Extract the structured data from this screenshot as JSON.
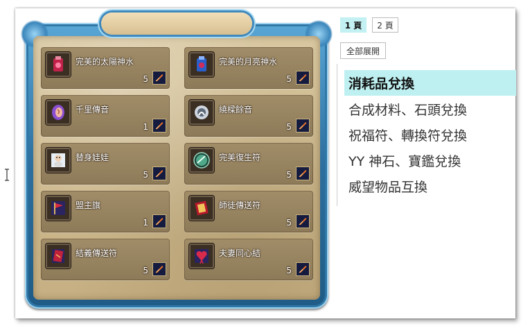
{
  "panel": {
    "items": [
      {
        "name": "完美的太陽神水",
        "qty": "5",
        "icon": "red-potion-icon"
      },
      {
        "name": "完美的月亮神水",
        "qty": "5",
        "icon": "blue-potion-icon"
      },
      {
        "name": "千里傳音",
        "qty": "1",
        "icon": "ear-icon"
      },
      {
        "name": "繞樑餘音",
        "qty": "5",
        "icon": "sound-ring-icon"
      },
      {
        "name": "替身娃娃",
        "qty": "5",
        "icon": "doll-icon"
      },
      {
        "name": "完美復生符",
        "qty": "5",
        "icon": "revive-orb-icon"
      },
      {
        "name": "盟主旗",
        "qty": "1",
        "icon": "flag-icon"
      },
      {
        "name": "師徒傳送符",
        "qty": "5",
        "icon": "red-scroll-icon"
      },
      {
        "name": "結義傳送符",
        "qty": "5",
        "icon": "red-card-icon"
      },
      {
        "name": "夫妻同心結",
        "qty": "5",
        "icon": "heart-knot-icon"
      }
    ]
  },
  "pagination": {
    "pages": [
      {
        "label": "1 頁",
        "active": true
      },
      {
        "label": "2 頁",
        "active": false
      }
    ],
    "expand_all": "全部展開"
  },
  "categories": [
    {
      "label": "消耗品兌換",
      "active": true
    },
    {
      "label": "合成材料、石頭兌換",
      "active": false
    },
    {
      "label": "祝福符、轉換符兌換",
      "active": false
    },
    {
      "label": "YY 神石、寶鑑兌換",
      "active": false
    },
    {
      "label": "威望物品互換",
      "active": false
    }
  ],
  "colors": {
    "active_tab_bg": "#c3f0f2",
    "panel_frame": "#2f77a7",
    "parchment": "#cdb98e"
  }
}
